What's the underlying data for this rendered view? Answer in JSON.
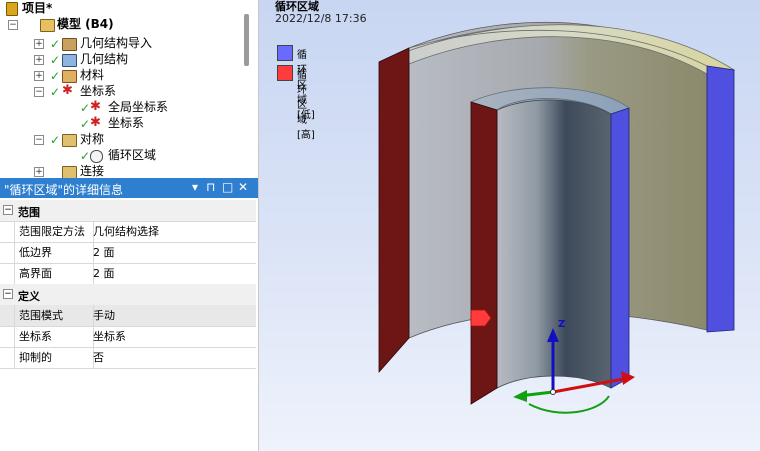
{
  "tree": {
    "root": "项目*",
    "model": "模型 (B4)",
    "items": [
      {
        "label": "几何结构导入"
      },
      {
        "label": "几何结构"
      },
      {
        "label": "材料"
      },
      {
        "label": "坐标系"
      },
      {
        "label": "全局坐标系"
      },
      {
        "label": "坐标系"
      },
      {
        "label": "对称"
      },
      {
        "label": "循环区域"
      },
      {
        "label": "连接"
      }
    ]
  },
  "details": {
    "title": "\"循环区域\"的详细信息",
    "buttons": [
      "▾",
      "⊓",
      "□",
      "✕"
    ],
    "sections": [
      {
        "label": "范围",
        "rows": [
          {
            "key": "范围限定方法",
            "value": "几何结构选择"
          },
          {
            "key": "低边界",
            "value": "2 面"
          },
          {
            "key": "高界面",
            "value": "2 面"
          }
        ]
      },
      {
        "label": "定义",
        "rows": [
          {
            "key": "范围模式",
            "value": "手动"
          },
          {
            "key": "坐标系",
            "value": "坐标系"
          },
          {
            "key": "抑制的",
            "value": "否"
          }
        ]
      }
    ]
  },
  "viewport": {
    "title": "循环区域",
    "timestamp": "2022/12/8 17:36",
    "legend": [
      {
        "label": "循环区域 [低]",
        "color": "#6a6aff"
      },
      {
        "label": "循环区域 [高]",
        "color": "#ff3b3b"
      }
    ],
    "axis_label": "Z"
  },
  "colors": {
    "accent": "#2f7fd0",
    "low": "#5050e0",
    "high": "#6e1616",
    "axis_z": "#1010c0",
    "axis_x": "#d01010",
    "axis_y": "#10a010"
  }
}
